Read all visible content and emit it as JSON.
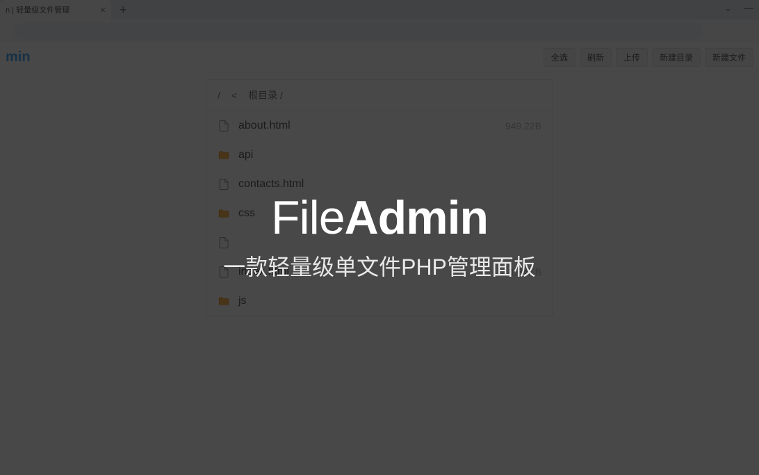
{
  "browser": {
    "tab_title": "n | 轻量级文件管理",
    "window_controls": {
      "menu": "⌄",
      "minimize": "—"
    }
  },
  "header": {
    "logo": "min",
    "toolbar": {
      "select_all": "全选",
      "refresh": "刷新",
      "upload": "上传",
      "new_folder": "新建目录",
      "new_file": "新建文件"
    }
  },
  "breadcrumb": {
    "root": "/",
    "back": "<",
    "label": "根目录 /"
  },
  "files": [
    {
      "name": "about.html",
      "type": "file",
      "size": "949.22B"
    },
    {
      "name": "api",
      "type": "folder",
      "size": ""
    },
    {
      "name": "contacts.html",
      "type": "file",
      "size": ""
    },
    {
      "name": "css",
      "type": "folder",
      "size": ""
    },
    {
      "name": "",
      "type": "file",
      "size": ""
    },
    {
      "name": "index.html",
      "type": "file",
      "size": "1.34KB"
    },
    {
      "name": "js",
      "type": "folder",
      "size": ""
    }
  ],
  "overlay": {
    "title_light": "File",
    "title_bold": "Admin",
    "subtitle": "一款轻量级单文件PHP管理面板"
  }
}
